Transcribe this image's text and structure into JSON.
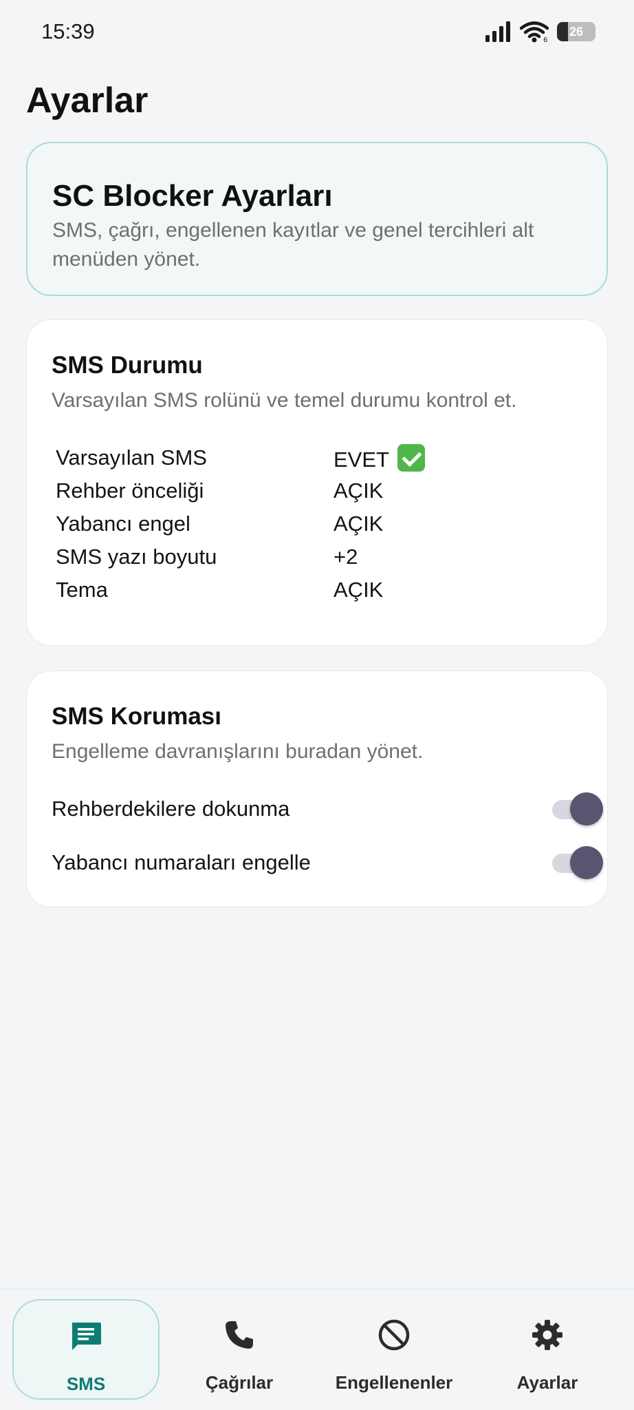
{
  "status_bar": {
    "time": "15:39",
    "battery": "26",
    "icons": [
      "signal-icon",
      "wifi-icon",
      "battery-icon"
    ]
  },
  "page": {
    "title": "Ayarlar"
  },
  "header_card": {
    "title": "SC Blocker Ayarları",
    "subtitle": "SMS, çağrı, engellenen kayıtlar ve genel tercihleri alt menüden yönet."
  },
  "sms_status": {
    "title": "SMS Durumu",
    "subtitle": "Varsayılan SMS rolünü ve temel durumu kontrol et.",
    "rows": [
      {
        "key": "Varsayılan SMS",
        "value": "EVET"
      },
      {
        "key": "Rehber önceliği",
        "value": "AÇIK"
      },
      {
        "key": "Yabancı engel",
        "value": "AÇIK"
      },
      {
        "key": "SMS yazı boyutu",
        "value": "+2"
      },
      {
        "key": "Tema",
        "value": "AÇIK"
      }
    ]
  },
  "sms_protection": {
    "title": "SMS Koruması",
    "subtitle": "Engelleme davranışlarını buradan yönet.",
    "toggles": [
      {
        "label": "Rehberdekilere dokunma",
        "on": true
      },
      {
        "label": "Yabancı numaraları engelle",
        "on": true
      }
    ]
  },
  "bottom_nav": {
    "items": [
      {
        "label": "SMS",
        "icon": "message-icon",
        "active": true
      },
      {
        "label": "Çağrılar",
        "icon": "phone-icon",
        "active": false
      },
      {
        "label": "Engellenenler",
        "icon": "block-icon",
        "active": false
      },
      {
        "label": "Ayarlar",
        "icon": "gear-icon",
        "active": false
      }
    ]
  },
  "colors": {
    "background": "#f3f5f7",
    "accent": "#0d7d72",
    "accent_border": "#a9dcd6",
    "toggle_thumb": "#5b5470",
    "toggle_track": "#d8d6de"
  }
}
